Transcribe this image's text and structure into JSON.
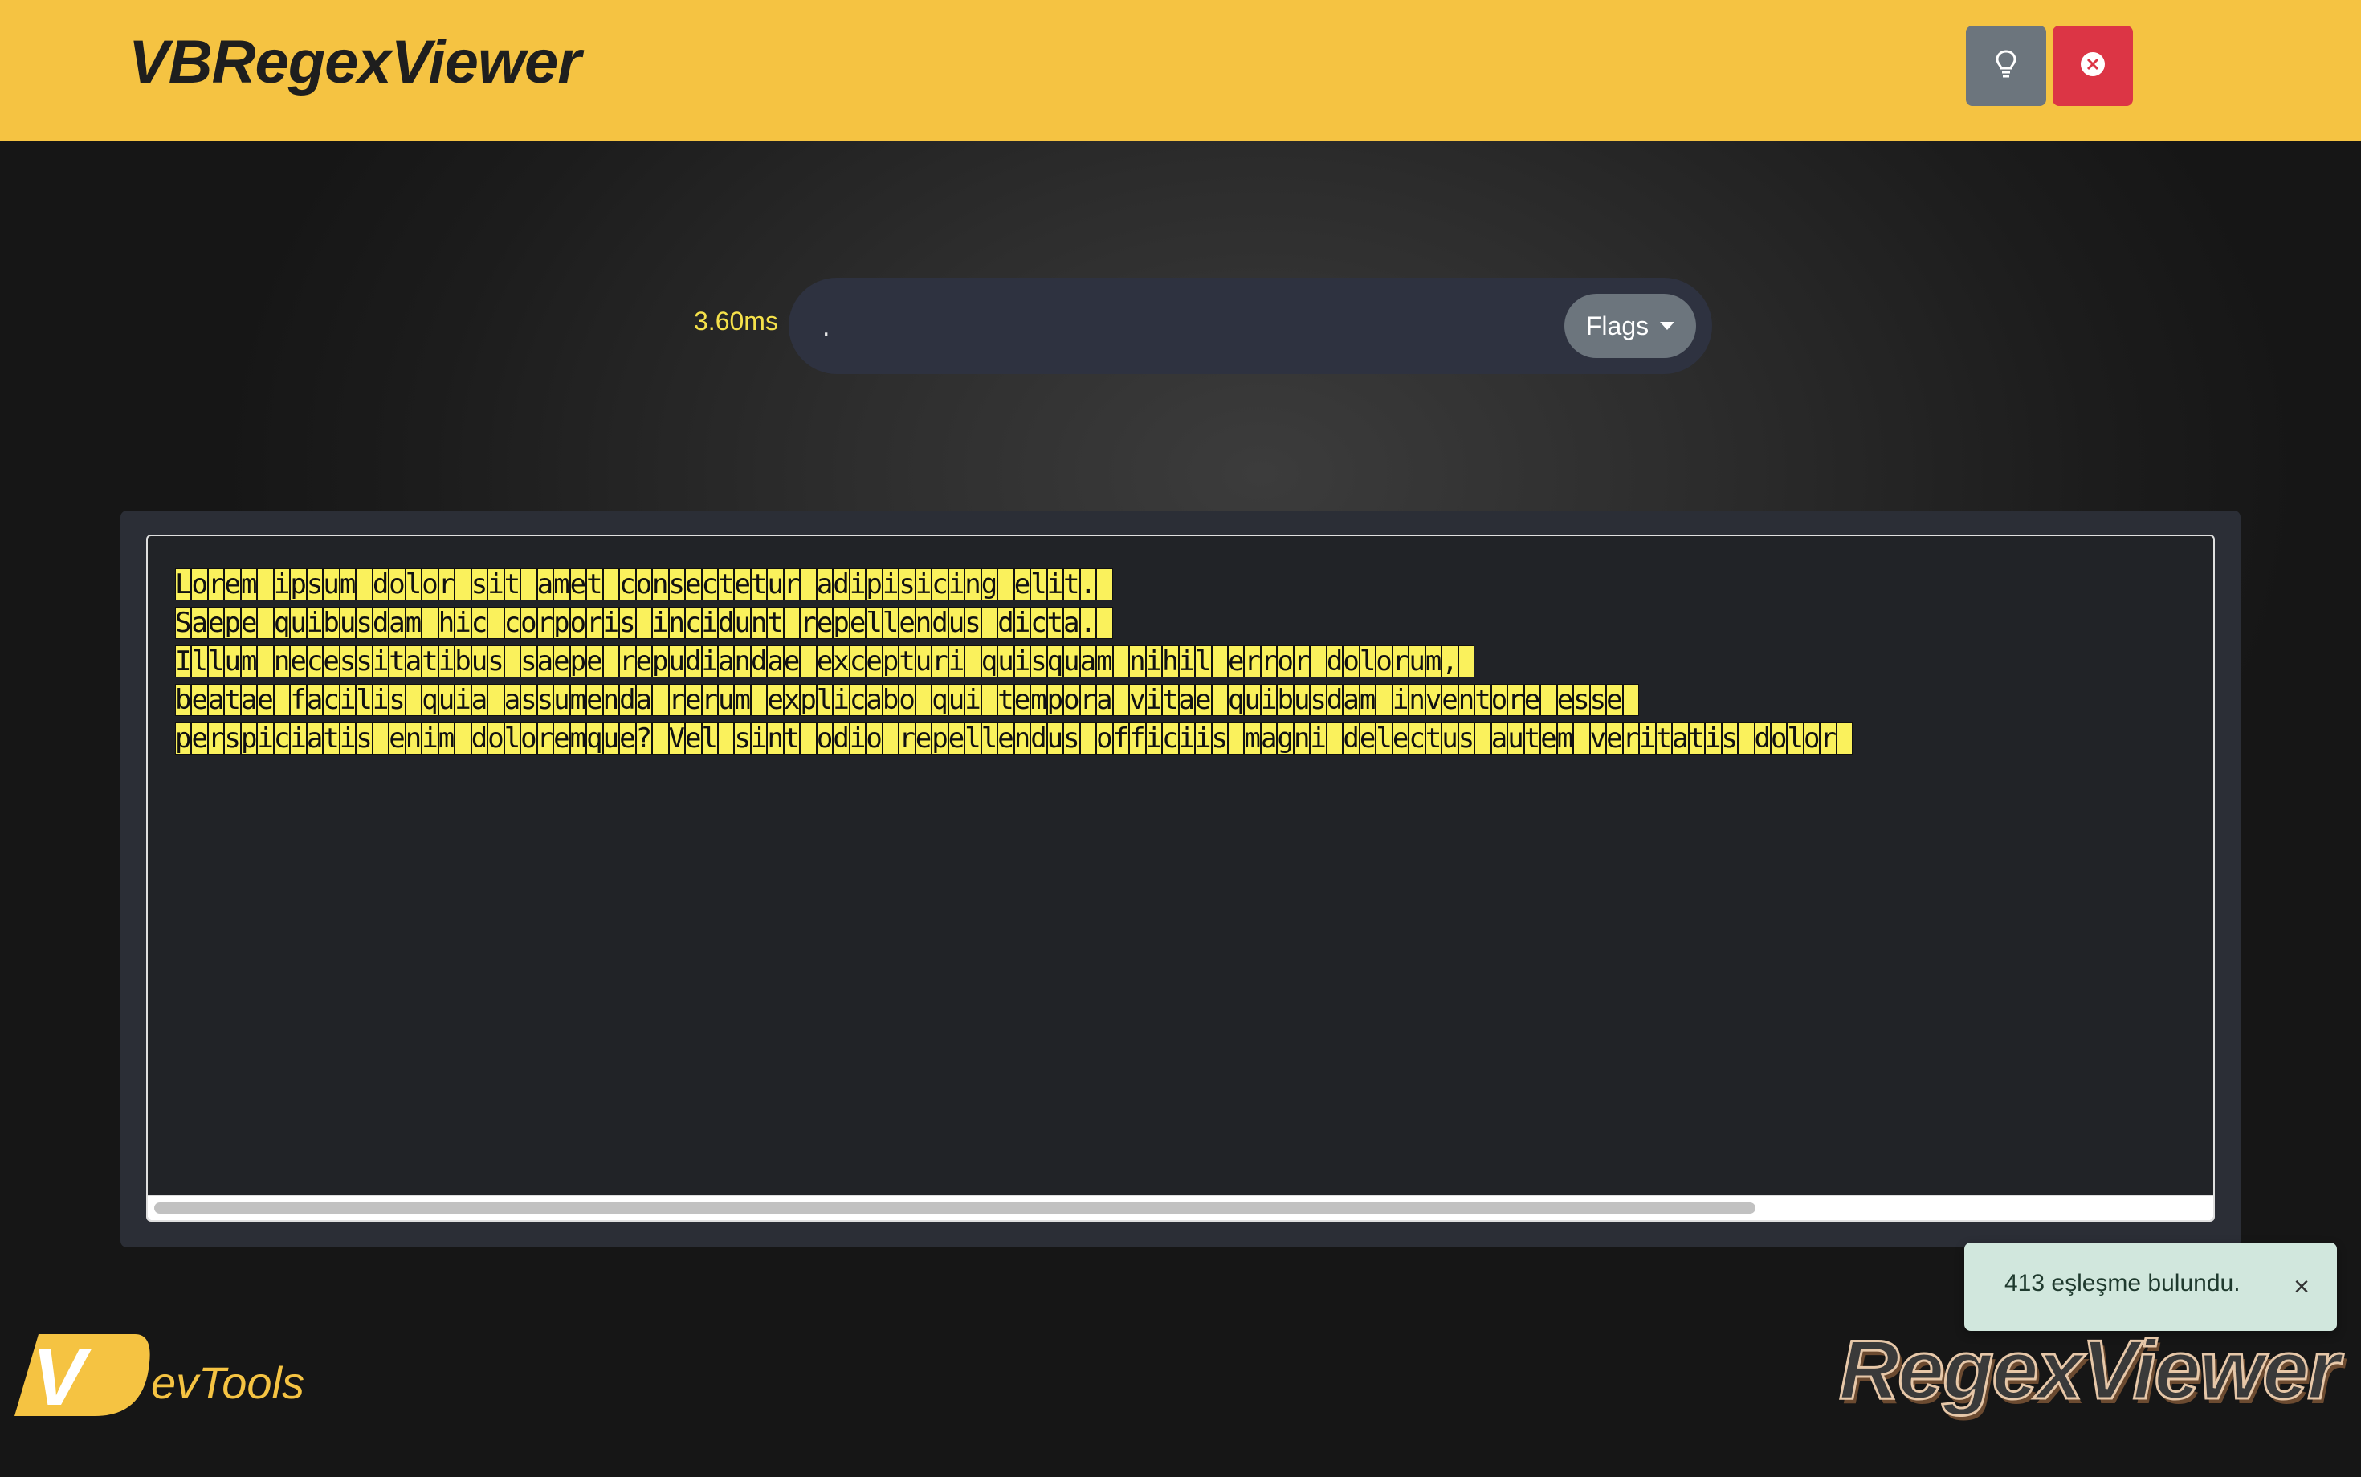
{
  "header": {
    "title": "VBRegexViewer",
    "hint_icon": "lightbulb-icon",
    "close_icon": "close-circle-icon"
  },
  "regex": {
    "timing": "3.60ms",
    "pattern": ".",
    "flags_label": "Flags"
  },
  "editor": {
    "lines": [
      "Lorem ipsum dolor sit amet consectetur adipisicing elit.",
      "Saepe quibusdam hic corporis incidunt repellendus dicta.",
      "Illum necessitatibus saepe repudiandae excepturi quisquam nihil error dolorum,",
      "beatae facilis quia assumenda rerum explicabo qui tempora vitae quibusdam inventore esse",
      "perspiciatis enim doloremque? Vel sint odio repellendus officiis magni delectus autem veritatis dolor"
    ],
    "scroll_fraction": 0.78
  },
  "toast": {
    "message": "413 eşleşme bulundu.",
    "close_label": "×"
  },
  "footer": {
    "devtools_mark": "V",
    "devtools_label": "evTools",
    "brand_label": "RegexViewer"
  },
  "colors": {
    "header_bg": "#f5c342",
    "match_highlight": "#faf15c",
    "hint_button": "#6c757d",
    "close_button": "#dc3545",
    "toast_bg": "#d1e7dd"
  }
}
